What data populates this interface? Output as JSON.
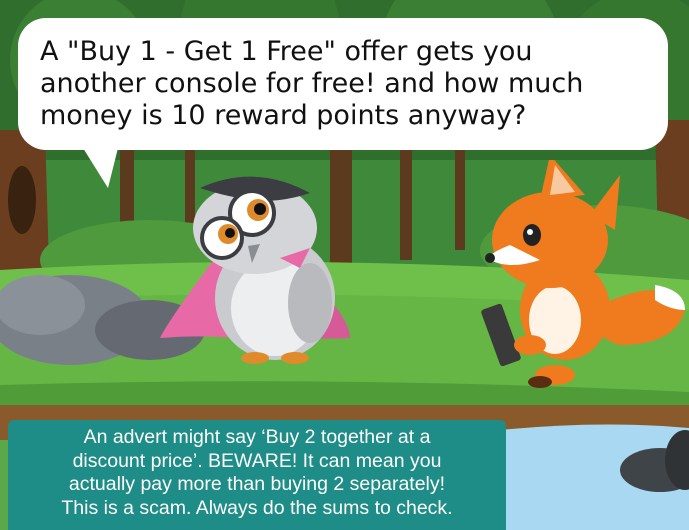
{
  "speech_bubble": {
    "lines": [
      "A \"Buy 1 - Get 1 Free\" offer gets you",
      "another console for free! and how much",
      "money is 10 reward points  anyway?"
    ]
  },
  "caption": {
    "lines": [
      "An advert might say ‘Buy 2 together at a",
      "discount price’. BEWARE! It can mean you",
      "actually pay more than buying 2 separately!",
      "This is a scam. Always do the sums to check."
    ]
  },
  "characters": {
    "owl": "owl-character",
    "fox": "fox-character",
    "fox_device": "phone-device"
  },
  "colors": {
    "caption_bg": "#1e8c87",
    "bubble_bg": "#ffffff",
    "grass": "#5aa84a",
    "fox": "#f07a1e"
  }
}
